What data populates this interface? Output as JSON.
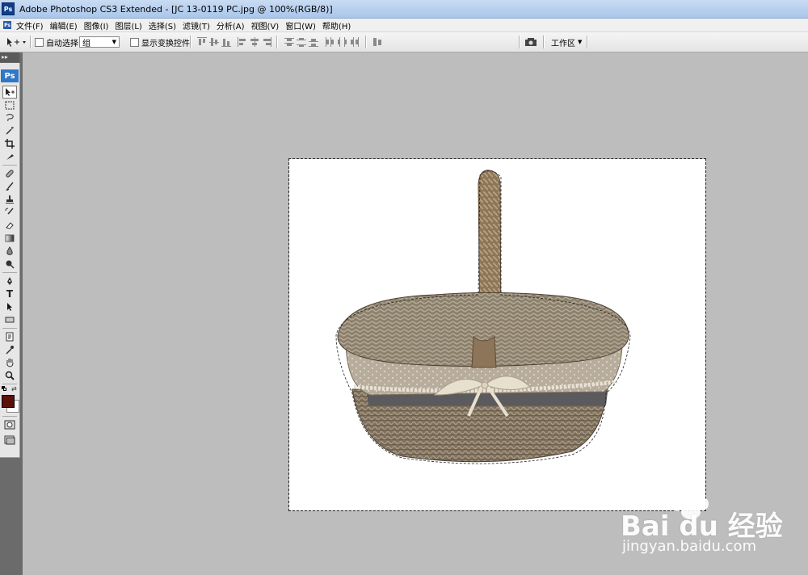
{
  "window": {
    "title": "Adobe Photoshop CS3 Extended - [JC 13-0119 PC.jpg @ 100%(RGB/8)]",
    "app_icon": "Ps"
  },
  "menu": {
    "items": [
      "文件(F)",
      "编辑(E)",
      "图像(I)",
      "图层(L)",
      "选择(S)",
      "滤镜(T)",
      "分析(A)",
      "视图(V)",
      "窗口(W)",
      "帮助(H)"
    ]
  },
  "options": {
    "auto_select_label": "自动选择:",
    "auto_select_value": "组",
    "show_transform_label": "显示变换控件",
    "workspace_label": "工作区"
  },
  "toolbox": {
    "logo": "Ps",
    "tools": [
      "move-tool",
      "marquee-tool",
      "lasso-tool",
      "magic-wand-tool",
      "crop-tool",
      "eyedropper-slice-tool",
      "healing-brush-tool",
      "brush-tool",
      "clone-stamp-tool",
      "history-brush-tool",
      "eraser-tool",
      "gradient-tool",
      "blur-tool",
      "dodge-tool",
      "pen-tool",
      "type-tool",
      "path-selection-tool",
      "shape-tool",
      "notes-tool",
      "eyedropper-tool",
      "hand-tool",
      "zoom-tool"
    ]
  },
  "colors": {
    "foreground": "#5a1208",
    "background": "#ffffff",
    "workspace": "#bdbdbd"
  },
  "watermark": {
    "brand": "Bai du 经验",
    "url": "jingyan.baidu.com"
  }
}
